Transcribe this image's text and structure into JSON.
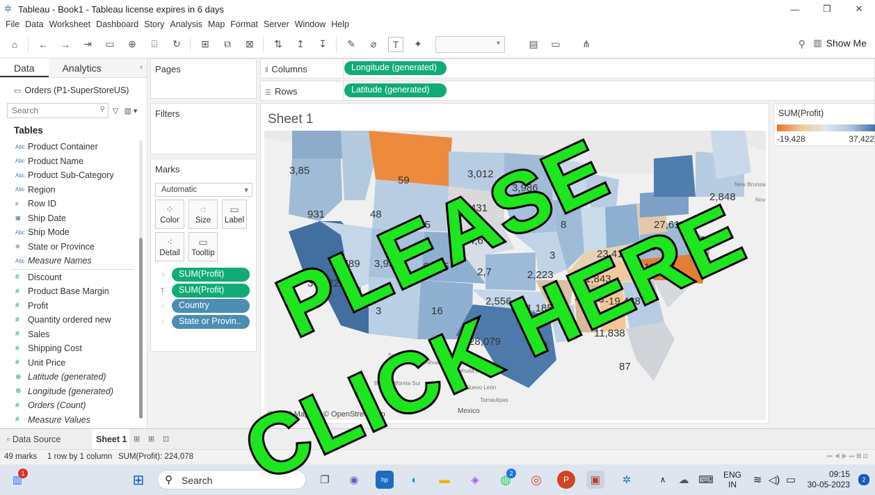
{
  "window": {
    "title": "Tableau - Book1 - Tableau license expires in 6 days",
    "minimize": "—",
    "maximize": "❐",
    "close": "✕"
  },
  "menu": [
    "File",
    "Data",
    "Worksheet",
    "Dashboard",
    "Story",
    "Analysis",
    "Map",
    "Format",
    "Server",
    "Window",
    "Help"
  ],
  "toolbar": {
    "show_me": "Show Me"
  },
  "left_panel": {
    "tabs": [
      "Data",
      "Analytics"
    ],
    "datasource": "Orders (P1-SuperStoreUS)",
    "search_placeholder": "Search",
    "tables_heading": "Tables",
    "dimensions": [
      {
        "type": "Abc",
        "label": "Product Container"
      },
      {
        "type": "Abc",
        "label": "Product Name"
      },
      {
        "type": "Abc",
        "label": "Product Sub-Category"
      },
      {
        "type": "Abc",
        "label": "Region"
      },
      {
        "type": "#",
        "label": "Row ID"
      },
      {
        "type": "date",
        "label": "Ship Date"
      },
      {
        "type": "Abc",
        "label": "Ship Mode"
      },
      {
        "type": "geo",
        "label": "State or Province"
      },
      {
        "type": "Abc",
        "label": "Measure Names"
      }
    ],
    "measures": [
      {
        "type": "#",
        "label": "Discount"
      },
      {
        "type": "#",
        "label": "Product Base Margin"
      },
      {
        "type": "#",
        "label": "Profit"
      },
      {
        "type": "#",
        "label": "Quantity ordered new"
      },
      {
        "type": "#",
        "label": "Sales"
      },
      {
        "type": "#",
        "label": "Shipping Cost"
      },
      {
        "type": "#",
        "label": "Unit Price"
      },
      {
        "type": "geo",
        "label": "Latitude (generated)"
      },
      {
        "type": "geo",
        "label": "Longitude (generated)"
      },
      {
        "type": "#",
        "label": "Orders (Count)"
      },
      {
        "type": "#",
        "label": "Measure Values"
      }
    ]
  },
  "pages_label": "Pages",
  "filters_label": "Filters",
  "marks": {
    "label": "Marks",
    "type": "Automatic",
    "buttons": [
      "Color",
      "Size",
      "Label",
      "Detail",
      "Tooltip"
    ],
    "pills": [
      "SUM(Profit)",
      "SUM(Profit)",
      "Country",
      "State or Provin.."
    ]
  },
  "columns": {
    "label": "Columns",
    "pill": "Longitude (generated)"
  },
  "rows": {
    "label": "Rows",
    "pill": "Latitude (generated)"
  },
  "sheet_title": "Sheet 1",
  "map": {
    "attribution": "© 2023 Mapbox © OpenStreetMap",
    "state_labels": [
      {
        "text": "3,85"
      },
      {
        "text": "59"
      },
      {
        "text": "3,012"
      },
      {
        "text": "3,986"
      },
      {
        "text": "431"
      },
      {
        "text": "931"
      },
      {
        "text": "48"
      },
      {
        "text": "735"
      },
      {
        "text": "4,6"
      },
      {
        "text": "2,848"
      },
      {
        "text": "27,612"
      },
      {
        "text": "5,073"
      },
      {
        "text": "-1,096"
      },
      {
        "text": "23,411"
      },
      {
        "text": "11,677"
      },
      {
        "text": "3,789"
      },
      {
        "text": "3,93"
      },
      {
        "text": "6,965"
      },
      {
        "text": "37,422"
      },
      {
        "text": "-1,843"
      },
      {
        "text": "2,556"
      },
      {
        "text": "-1,185"
      },
      {
        "text": "-1,603"
      },
      {
        "text": "-19,428"
      },
      {
        "text": "3"
      },
      {
        "text": "16"
      },
      {
        "text": "28,079"
      },
      {
        "text": "710"
      },
      {
        "text": "11,838"
      },
      {
        "text": "87"
      },
      {
        "text": "2,7"
      },
      {
        "text": "2,223"
      },
      {
        "text": "3"
      },
      {
        "text": "8"
      }
    ],
    "place_labels": [
      "Sonora",
      "Chihuahua",
      "Coahuila de Zaragoza",
      "Baja California Sur",
      "Nuevo León",
      "Tamaulipas",
      "Mexico",
      "New Brunswick",
      "Nov"
    ]
  },
  "legend": {
    "title": "SUM(Profit)",
    "min": "-19,428",
    "max": "37,422"
  },
  "overlay": {
    "line1": "PLEASE",
    "line2": "CLICK HERE"
  },
  "tabs": {
    "data_source": "Data Source",
    "sheet": "Sheet 1"
  },
  "status": {
    "marks": "49 marks",
    "dims": "1 row by 1 column",
    "sum": "SUM(Profit): 224,078"
  },
  "taskbar": {
    "search": "Search",
    "lang1": "ENG",
    "lang2": "IN",
    "time": "09:15",
    "date": "30-05-2023",
    "badge_widget": "1",
    "badge_whatsapp": "2",
    "badge_notify": "2"
  },
  "colors": {
    "pill_green": "#10ab77",
    "pill_blue": "#4a8eb3",
    "overlay_green": "#1ee61e",
    "negative": "#e3782f",
    "positive": "#3e6fa5"
  }
}
